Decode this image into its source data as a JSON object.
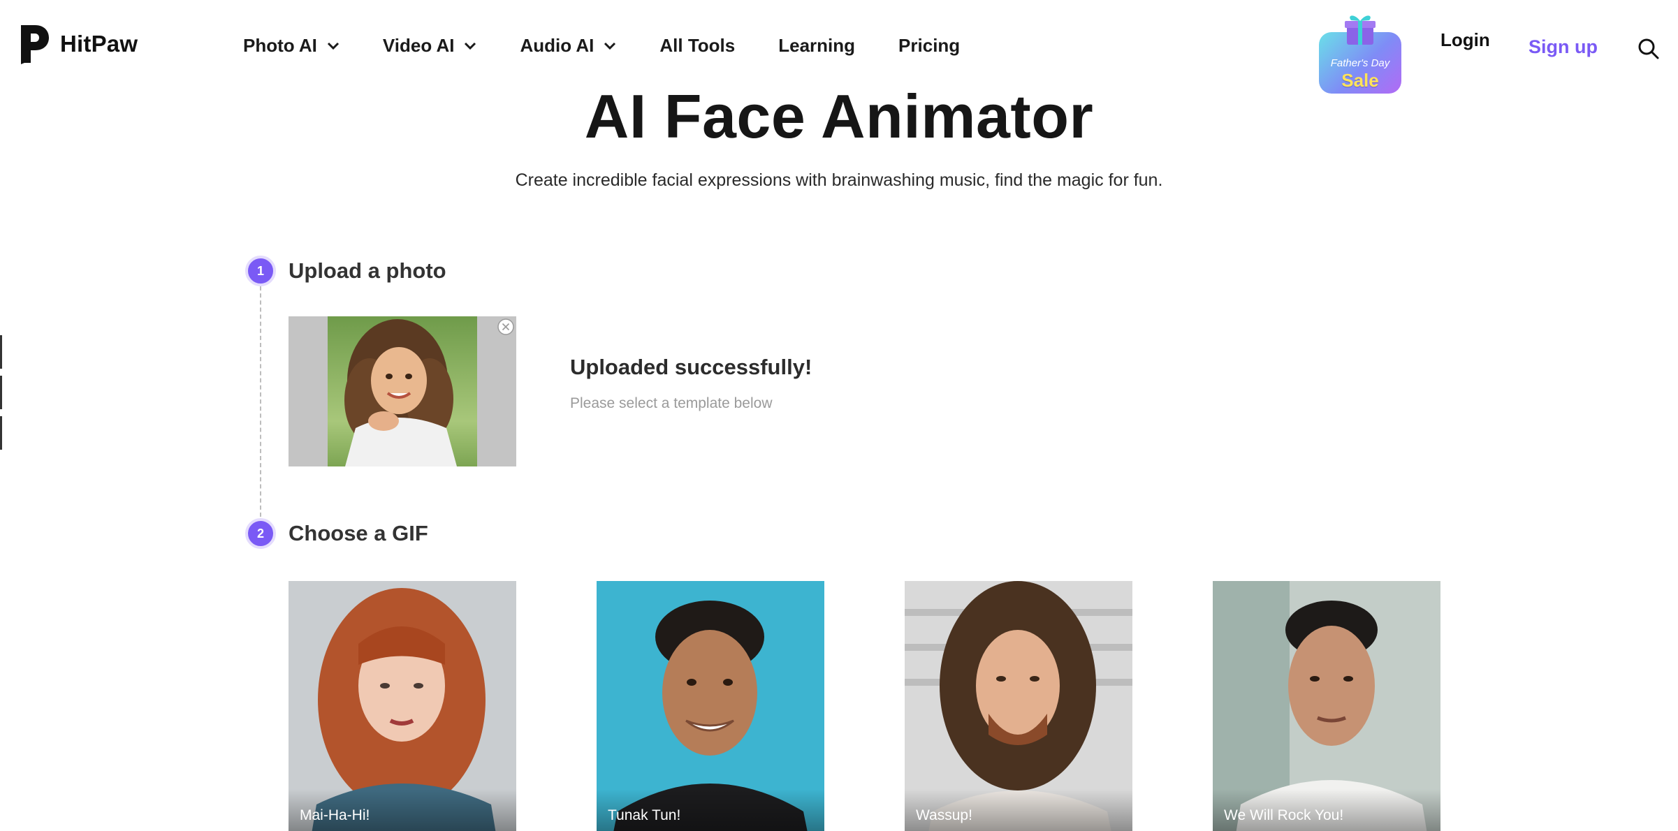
{
  "header": {
    "brand": "HitPaw",
    "nav": [
      {
        "label": "Photo AI",
        "has_dropdown": true
      },
      {
        "label": "Video AI",
        "has_dropdown": true
      },
      {
        "label": "Audio AI",
        "has_dropdown": true
      },
      {
        "label": "All Tools",
        "has_dropdown": false
      },
      {
        "label": "Learning",
        "has_dropdown": false
      },
      {
        "label": "Pricing",
        "has_dropdown": false
      }
    ],
    "promo": {
      "line1": "Father's Day",
      "line2": "Sale"
    },
    "login": "Login",
    "signup": "Sign up",
    "search_icon": "search-icon"
  },
  "hero": {
    "title": "AI Face Animator",
    "subtitle": "Create incredible facial expressions with brainwashing music, find the magic for fun."
  },
  "steps": [
    {
      "number": "1",
      "title": "Upload a photo"
    },
    {
      "number": "2",
      "title": "Choose a GIF"
    }
  ],
  "upload": {
    "status": "Uploaded successfully!",
    "hint": "Please select a template below"
  },
  "gifs": [
    {
      "label": "Mai-Ha-Hi!"
    },
    {
      "label": "Tunak Tun!"
    },
    {
      "label": "Wassup!"
    },
    {
      "label": "We Will Rock You!"
    }
  ],
  "colors": {
    "accent": "#7a5af5",
    "text": "#1a1a1a",
    "muted": "#9a9a9a"
  }
}
